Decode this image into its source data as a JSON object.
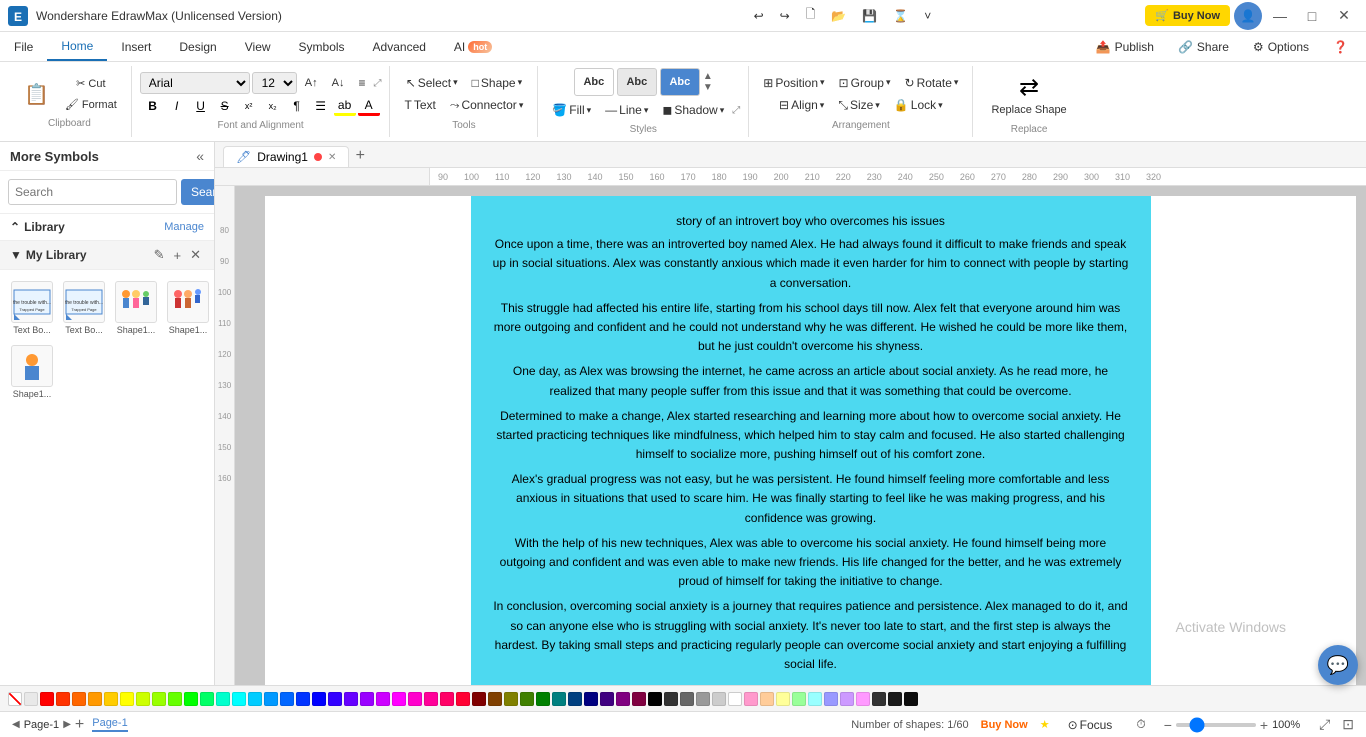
{
  "app": {
    "title": "Wondershare EdrawMax (Unlicensed Version)",
    "logo_text": "E"
  },
  "title_bar": {
    "undo_label": "↩",
    "redo_label": "↪",
    "new_label": "🗋",
    "open_label": "📂",
    "save_label": "💾",
    "history_label": "⌛",
    "more_label": "˅",
    "buy_now": "Buy Now",
    "minimize": "—",
    "maximize": "□",
    "close": "✕"
  },
  "menu_bar": {
    "items": [
      "File",
      "Home",
      "Insert",
      "Design",
      "View",
      "Symbols",
      "Advanced"
    ],
    "active": "Home",
    "ai_label": "AI",
    "ai_badge": "hot",
    "publish": "Publish",
    "share": "Share",
    "options": "Options",
    "help": "?"
  },
  "toolbar": {
    "clipboard": {
      "label": "Clipboard",
      "paste": "📋",
      "cut": "✂",
      "format_painter": "🖌"
    },
    "font": {
      "label": "Font and Alignment",
      "name": "Arial",
      "size": "12",
      "grow": "A↑",
      "shrink": "A↓",
      "align": "≡",
      "bold": "B",
      "italic": "I",
      "underline": "U",
      "strikethrough": "S",
      "superscript": "x²",
      "subscript": "x₂",
      "paragraph": "¶",
      "list": "☰",
      "highlight": "ab",
      "font_color": "A",
      "expand": "⤢"
    },
    "tools": {
      "label": "Tools",
      "select": "Select",
      "select_caret": "▾",
      "shape": "Shape",
      "shape_caret": "▾",
      "text": "Text",
      "connector": "Connector",
      "connector_caret": "▾"
    },
    "styles": {
      "label": "Styles",
      "swatch1": "Abc",
      "swatch2": "Abc",
      "swatch3": "Abc",
      "fill": "Fill",
      "line": "Line",
      "shadow": "Shadow",
      "expand": "⤢"
    },
    "arrangement": {
      "label": "Arrangement",
      "position": "Position",
      "group": "Group",
      "rotate": "Rotate",
      "align": "Align",
      "size": "Size",
      "lock": "Lock"
    },
    "replace": {
      "label": "Replace",
      "replace_shape": "Replace Shape"
    }
  },
  "sidebar": {
    "title": "More Symbols",
    "collapse_label": "«",
    "search_placeholder": "Search",
    "search_btn": "Search",
    "library": {
      "title": "Library",
      "manage": "Manage",
      "expand_icon": "⌃"
    },
    "my_library": {
      "title": "My Library",
      "edit_icon": "✎",
      "add_icon": "+",
      "close_icon": "✕",
      "items": [
        {
          "name": "Text Bo...",
          "type": "text"
        },
        {
          "name": "Text Bo...",
          "type": "text"
        },
        {
          "name": "Shape1...",
          "type": "shape"
        },
        {
          "name": "Shape1...",
          "type": "shape"
        },
        {
          "name": "Shape1...",
          "type": "shape_single"
        }
      ]
    }
  },
  "tabs": {
    "drawing1": "Drawing1",
    "dot_color": "#ff4444",
    "add_tab": "+"
  },
  "canvas": {
    "story_title": "story of an introvert boy who overcomes his issues",
    "paragraph1": "Once upon a time, there was an introverted boy named Alex. He had always found it difficult to make friends and speak up in social situations. Alex was constantly anxious which made it even harder for him to connect with people by starting a conversation.",
    "paragraph2": "This struggle had affected his entire life, starting from his school days till now. Alex felt that everyone around him was more outgoing and confident and he could not understand why he was different. He wished he could be more like them, but he just couldn't overcome his shyness.",
    "paragraph3": "One day, as Alex was browsing the internet, he came across an article about social anxiety. As he read more, he realized that many people suffer from this issue and that it was something that could be overcome.",
    "paragraph4": "Determined to make a change, Alex started researching and learning more about how to overcome social anxiety. He started practicing techniques like mindfulness, which helped him to stay calm and focused. He also started challenging himself to socialize more, pushing himself out of his comfort zone.",
    "paragraph5": "Alex's gradual progress was not easy, but he was persistent. He found himself feeling more comfortable and less anxious in situations that used to scare him. He was finally starting to feel like he was making progress, and his confidence was growing.",
    "paragraph6": "With the help of his new techniques, Alex was able to overcome his social anxiety. He found himself being more outgoing and confident and was even able to make new friends. His life changed for the better, and he was extremely proud of himself for taking the initiative to change.",
    "paragraph7": "In conclusion, overcoming social anxiety is a journey that requires patience and persistence. Alex managed to do it, and so can anyone else who is struggling with social anxiety. It's never too late to start, and the first step is always the hardest. By taking small steps and practicing regularly people can overcome social anxiety and start enjoying a fulfilling social life."
  },
  "status_bar": {
    "page_label": "Page-1",
    "add_page": "+",
    "tab_label": "Page-1",
    "shapes_info": "Number of shapes: 1/60",
    "buy_now": "Buy Now",
    "focus_label": "Focus",
    "zoom_level": "100%",
    "zoom_out": "−",
    "zoom_in": "+",
    "fit_screen": "⤢",
    "fit_page": "⊡"
  },
  "watermark": "Activate Windows",
  "colors": {
    "accent_blue": "#4a86cf",
    "text_box_bg": "#4dd9f0",
    "buy_now_yellow": "#ffd700",
    "toolbar_bg": "#ffffff"
  },
  "color_palette": [
    "#e8e8e8",
    "#ff0000",
    "#ff4400",
    "#ff8800",
    "#ffcc00",
    "#ffff00",
    "#88cc00",
    "#00cc00",
    "#00cc88",
    "#00cccc",
    "#0088cc",
    "#0044cc",
    "#4400cc",
    "#8800cc",
    "#cc00cc",
    "#cc0088",
    "#cc0044",
    "#800000",
    "#804000",
    "#808000",
    "#408000",
    "#008000",
    "#008040",
    "#008080",
    "#004080",
    "#000080",
    "#400080",
    "#800080",
    "#800040",
    "#000000",
    "#404040",
    "#808080",
    "#c0c0c0",
    "#ffffff",
    "#ff99cc",
    "#ffcc99",
    "#ffff99",
    "#99ff99",
    "#99ffff",
    "#9999ff",
    "#cc99ff",
    "#ff99ff"
  ]
}
